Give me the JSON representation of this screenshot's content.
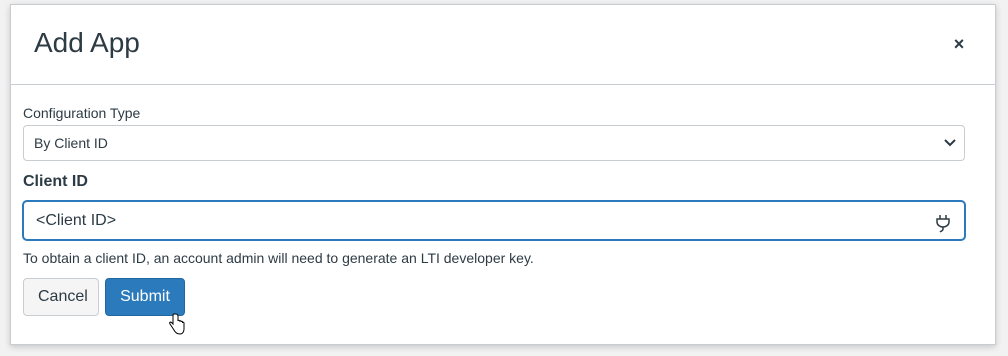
{
  "dialog": {
    "title": "Add App",
    "close_icon": "close-icon",
    "close_label": "×"
  },
  "configuration_type": {
    "label": "Configuration Type",
    "selected": "By Client ID"
  },
  "client_id": {
    "label": "Client ID",
    "value": "<Client ID>",
    "hint": "To obtain a client ID, an account admin will need to generate an LTI developer key."
  },
  "actions": {
    "cancel_label": "Cancel",
    "submit_label": "Submit"
  },
  "colors": {
    "accent": "#2b7abc",
    "text": "#2d3b45",
    "border": "#c7cdd1"
  }
}
